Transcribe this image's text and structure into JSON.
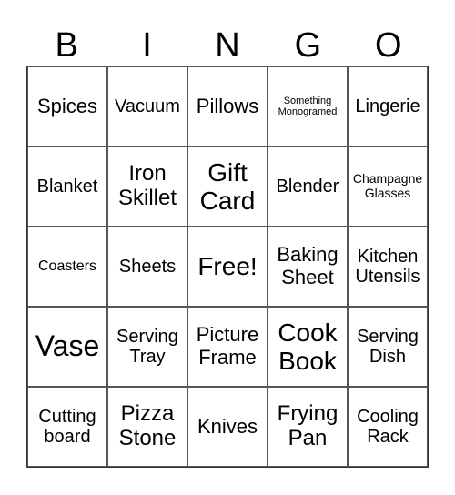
{
  "header": [
    "B",
    "I",
    "N",
    "G",
    "O"
  ],
  "cells": [
    [
      "Spices",
      "Vacuum",
      "Pillows",
      "Something Monogramed",
      "Lingerie"
    ],
    [
      "Blanket",
      "Iron Skillet",
      "Gift Card",
      "Blender",
      "Champagne Glasses"
    ],
    [
      "Coasters",
      "Sheets",
      "Free!",
      "Baking Sheet",
      "Kitchen Utensils"
    ],
    [
      "Vase",
      "Serving Tray",
      "Picture Frame",
      "Cook Book",
      "Serving Dish"
    ],
    [
      "Cutting board",
      "Pizza Stone",
      "Knives",
      "Frying Pan",
      "Cooling Rack"
    ]
  ]
}
